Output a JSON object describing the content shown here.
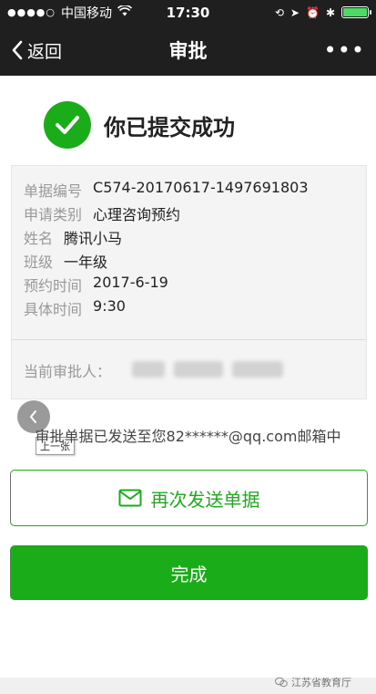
{
  "status_bar": {
    "carrier": "中国移动",
    "time": "17:30",
    "battery_color": "#4cd964"
  },
  "nav": {
    "back_label": "返回",
    "title": "审批",
    "more_label": "•••"
  },
  "success": {
    "message": "你已提交成功",
    "icon": "check-circle-icon",
    "color": "#1aad19"
  },
  "details": {
    "rows": [
      {
        "label": "单据编号",
        "value": "C574-20170617-1497691803"
      },
      {
        "label": "申请类别",
        "value": "心理咨询预约"
      },
      {
        "label": "姓名",
        "value": "腾讯小马"
      },
      {
        "label": "班级",
        "value": "一年级"
      },
      {
        "label": "预约时间",
        "value": "2017-6-19"
      },
      {
        "label": "具体时间",
        "value": "9:30"
      }
    ],
    "approver_label": "当前审批人："
  },
  "viewer": {
    "prev_tooltip": "上一张"
  },
  "sent_message": "审批单据已发送至您82******@qq.com邮箱中",
  "buttons": {
    "resend_label": "再次发送单据",
    "done_label": "完成"
  },
  "watermark": {
    "text": "江苏省教育厅"
  }
}
